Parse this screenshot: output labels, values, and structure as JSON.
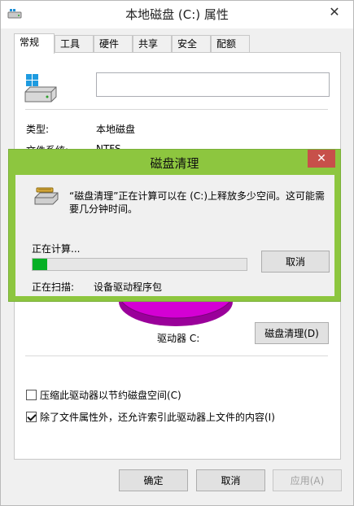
{
  "window": {
    "title": "本地磁盘 (C:) 属性",
    "close_glyph": "✕"
  },
  "tabs": [
    {
      "label": "常规",
      "active": true
    },
    {
      "label": "工具",
      "active": false
    },
    {
      "label": "硬件",
      "active": false
    },
    {
      "label": "共享",
      "active": false
    },
    {
      "label": "安全",
      "active": false
    },
    {
      "label": "配额",
      "active": false
    }
  ],
  "general": {
    "name_value": "",
    "type_label": "类型:",
    "type_value": "本地磁盘",
    "fs_label": "文件系统:",
    "fs_value": "NTFS",
    "drive_label": "驱动器 C:",
    "cleanup_button": "磁盘清理(D)",
    "compress_label": "压缩此驱动器以节约磁盘空间(C)",
    "compress_checked": false,
    "index_label": "除了文件属性外，还允许索引此驱动器上文件的内容(I)",
    "index_checked": true
  },
  "footer": {
    "ok": "确定",
    "cancel": "取消",
    "apply": "应用(A)"
  },
  "cleanup_dialog": {
    "title": "磁盘清理",
    "close_glyph": "✕",
    "message": "“磁盘清理”正在计算可以在 (C:)上释放多少空间。这可能需要几分钟时间。",
    "calculating": "正在计算...",
    "cancel_button": "取消",
    "scanning_label": "正在扫描:",
    "scanning_value": "设备驱动程序包",
    "progress": 0.07
  },
  "colors": {
    "dialog_frame": "#8dc63f",
    "close_button": "#c7504a",
    "progress_fill": "#06b025",
    "used_space": "#d400d4"
  }
}
